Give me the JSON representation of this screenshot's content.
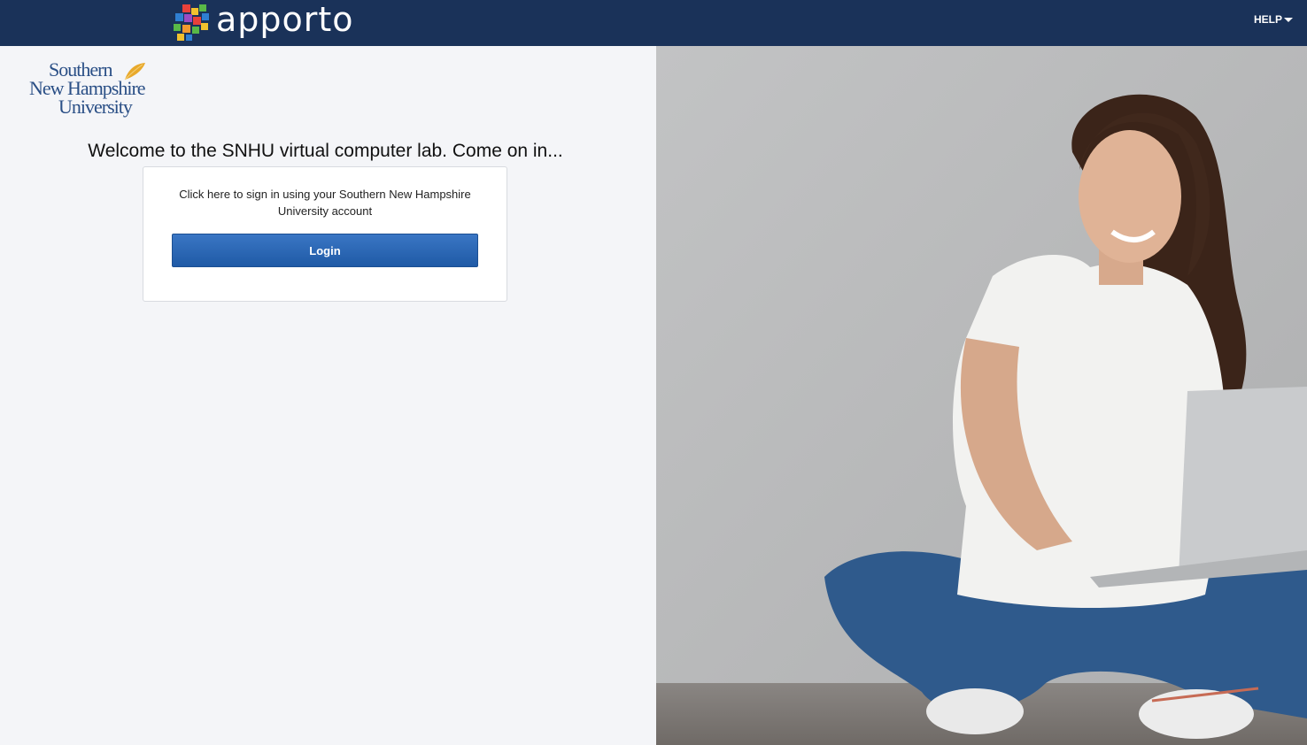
{
  "header": {
    "brand_name": "apporto",
    "help_label": "HELP"
  },
  "university": {
    "logo_line1": "Southern",
    "logo_line2": "New Hampshire",
    "logo_line3": "University"
  },
  "welcome": {
    "title": "Welcome to the SNHU virtual computer lab. Come on in..."
  },
  "login_card": {
    "instruction": "Click here to sign in using your Southern New Hampshire University account",
    "login_label": "Login"
  },
  "colors": {
    "topbar": "#1a3259",
    "button": "#2a67b6",
    "university_blue": "#2a4f86",
    "leaf_gold": "#e8a92c"
  }
}
